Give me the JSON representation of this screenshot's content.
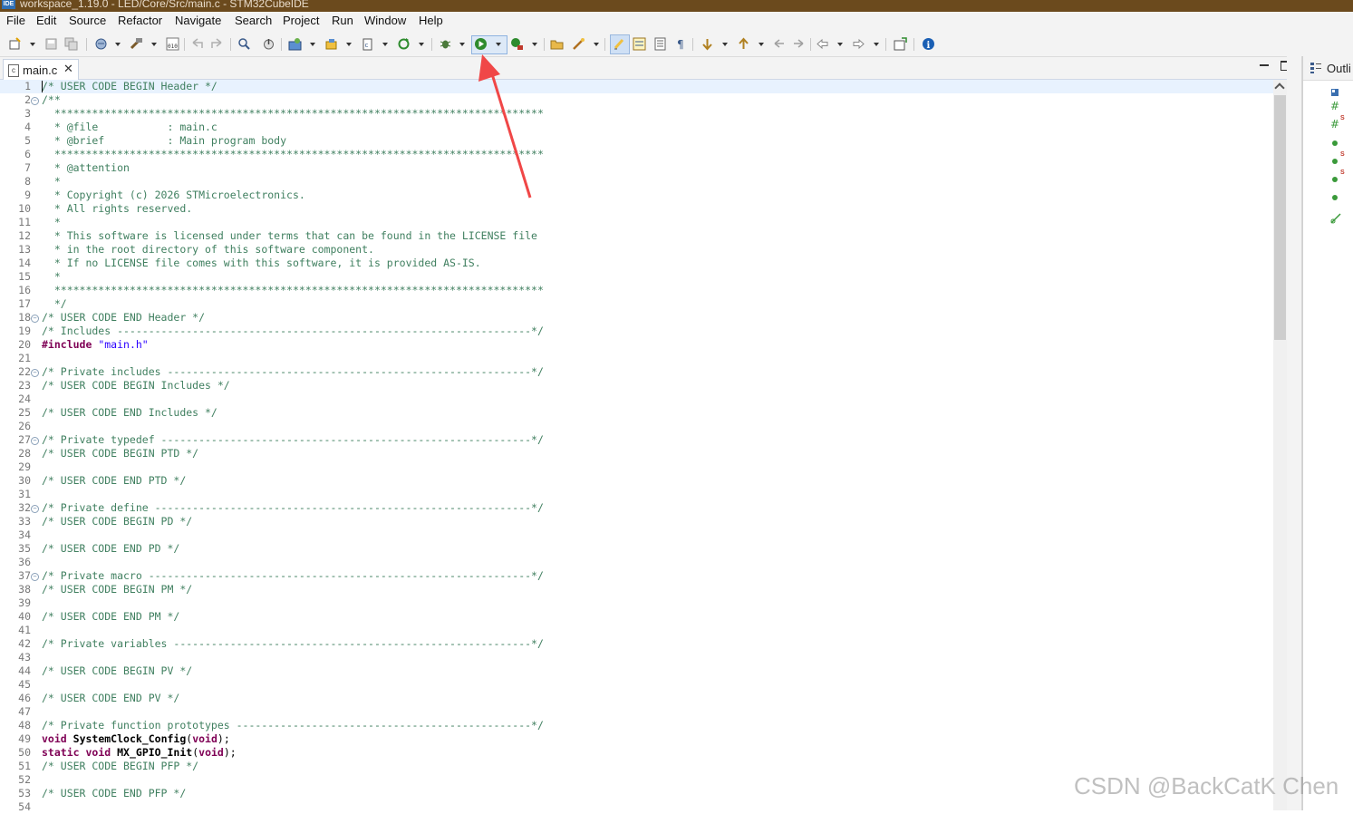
{
  "window": {
    "title": "workspace_1.19.0 - LED/Core/Src/main.c - STM32CubeIDE",
    "logo_text": "IDE"
  },
  "menu": [
    "File",
    "Edit",
    "Source",
    "Refactor",
    "Navigate",
    "Search",
    "Project",
    "Run",
    "Window",
    "Help"
  ],
  "toolbar": {
    "icons": [
      "new-icon",
      "save-icon",
      "save-all-icon",
      "build-config-icon",
      "build-icon",
      "binary-icon",
      "undo-icon",
      "redo-icon",
      "search-icon",
      "debug-probe-icon",
      "device-config-icon",
      "cube-icon",
      "new-file-icon",
      "refresh-icon",
      "debug-icon",
      "run-icon",
      "external-tools-icon",
      "open-folder-icon",
      "wand-icon",
      "highlight-icon",
      "toggle-mark-icon",
      "block-select-icon",
      "whitespace-icon",
      "next-annotation-icon",
      "prev-annotation-icon",
      "last-edit-icon",
      "back-nav-icon",
      "back-icon",
      "forward-icon",
      "perspective-icon",
      "info-icon"
    ],
    "highlight_color": "#2e8b2e"
  },
  "editor": {
    "tab_label": "main.c",
    "tab_icon": "c-file-icon",
    "lines": [
      {
        "n": "1",
        "segs": [
          [
            "c",
            "/* USER CODE BEGIN Header */"
          ]
        ],
        "current": true
      },
      {
        "n": "2",
        "fold": true,
        "segs": [
          [
            "c",
            "/**"
          ]
        ]
      },
      {
        "n": "3",
        "segs": [
          [
            "c",
            "  ******************************************************************************"
          ]
        ]
      },
      {
        "n": "4",
        "segs": [
          [
            "c",
            "  * @file           : main.c"
          ]
        ]
      },
      {
        "n": "5",
        "segs": [
          [
            "c",
            "  * @brief          : Main program body"
          ]
        ]
      },
      {
        "n": "6",
        "segs": [
          [
            "c",
            "  ******************************************************************************"
          ]
        ]
      },
      {
        "n": "7",
        "segs": [
          [
            "c",
            "  * @attention"
          ]
        ]
      },
      {
        "n": "8",
        "segs": [
          [
            "c",
            "  *"
          ]
        ]
      },
      {
        "n": "9",
        "segs": [
          [
            "c",
            "  * Copyright (c) 2026 STMicroelectronics."
          ]
        ]
      },
      {
        "n": "10",
        "segs": [
          [
            "c",
            "  * All rights reserved."
          ]
        ]
      },
      {
        "n": "11",
        "segs": [
          [
            "c",
            "  *"
          ]
        ]
      },
      {
        "n": "12",
        "segs": [
          [
            "c",
            "  * This software is licensed under terms that can be found in the LICENSE file"
          ]
        ]
      },
      {
        "n": "13",
        "segs": [
          [
            "c",
            "  * in the root directory of this software component."
          ]
        ]
      },
      {
        "n": "14",
        "segs": [
          [
            "c",
            "  * If no LICENSE file comes with this software, it is provided AS-IS."
          ]
        ]
      },
      {
        "n": "15",
        "segs": [
          [
            "c",
            "  *"
          ]
        ]
      },
      {
        "n": "16",
        "segs": [
          [
            "c",
            "  ******************************************************************************"
          ]
        ]
      },
      {
        "n": "17",
        "segs": [
          [
            "c",
            "  */"
          ]
        ]
      },
      {
        "n": "18",
        "fold": true,
        "segs": [
          [
            "c",
            "/* USER CODE END Header */"
          ]
        ]
      },
      {
        "n": "19",
        "segs": [
          [
            "c",
            "/* Includes ------------------------------------------------------------------*/"
          ]
        ]
      },
      {
        "n": "20",
        "segs": [
          [
            "k",
            "#include"
          ],
          [
            "p",
            " "
          ],
          [
            "s",
            "\"main.h\""
          ]
        ]
      },
      {
        "n": "21",
        "segs": []
      },
      {
        "n": "22",
        "fold": true,
        "segs": [
          [
            "c",
            "/* Private includes ----------------------------------------------------------*/"
          ]
        ]
      },
      {
        "n": "23",
        "segs": [
          [
            "c",
            "/* USER CODE BEGIN Includes */"
          ]
        ]
      },
      {
        "n": "24",
        "segs": []
      },
      {
        "n": "25",
        "segs": [
          [
            "c",
            "/* USER CODE END Includes */"
          ]
        ]
      },
      {
        "n": "26",
        "segs": []
      },
      {
        "n": "27",
        "fold": true,
        "segs": [
          [
            "c",
            "/* Private typedef -----------------------------------------------------------*/"
          ]
        ]
      },
      {
        "n": "28",
        "segs": [
          [
            "c",
            "/* USER CODE BEGIN PTD */"
          ]
        ]
      },
      {
        "n": "29",
        "segs": []
      },
      {
        "n": "30",
        "segs": [
          [
            "c",
            "/* USER CODE END PTD */"
          ]
        ]
      },
      {
        "n": "31",
        "segs": []
      },
      {
        "n": "32",
        "fold": true,
        "segs": [
          [
            "c",
            "/* Private define ------------------------------------------------------------*/"
          ]
        ]
      },
      {
        "n": "33",
        "segs": [
          [
            "c",
            "/* USER CODE BEGIN PD */"
          ]
        ]
      },
      {
        "n": "34",
        "segs": []
      },
      {
        "n": "35",
        "segs": [
          [
            "c",
            "/* USER CODE END PD */"
          ]
        ]
      },
      {
        "n": "36",
        "segs": []
      },
      {
        "n": "37",
        "fold": true,
        "segs": [
          [
            "c",
            "/* Private macro -------------------------------------------------------------*/"
          ]
        ]
      },
      {
        "n": "38",
        "segs": [
          [
            "c",
            "/* USER CODE BEGIN PM */"
          ]
        ]
      },
      {
        "n": "39",
        "segs": []
      },
      {
        "n": "40",
        "segs": [
          [
            "c",
            "/* USER CODE END PM */"
          ]
        ]
      },
      {
        "n": "41",
        "segs": []
      },
      {
        "n": "42",
        "segs": [
          [
            "c",
            "/* Private variables ---------------------------------------------------------*/"
          ]
        ]
      },
      {
        "n": "43",
        "segs": []
      },
      {
        "n": "44",
        "segs": [
          [
            "c",
            "/* USER CODE BEGIN PV */"
          ]
        ]
      },
      {
        "n": "45",
        "segs": []
      },
      {
        "n": "46",
        "segs": [
          [
            "c",
            "/* USER CODE END PV */"
          ]
        ]
      },
      {
        "n": "47",
        "segs": []
      },
      {
        "n": "48",
        "segs": [
          [
            "c",
            "/* Private function prototypes -----------------------------------------------*/"
          ]
        ]
      },
      {
        "n": "49",
        "segs": [
          [
            "k",
            "void"
          ],
          [
            "p",
            " "
          ],
          [
            "f",
            "SystemClock_Config"
          ],
          [
            "p",
            "("
          ],
          [
            "k",
            "void"
          ],
          [
            "p",
            ");"
          ]
        ]
      },
      {
        "n": "50",
        "segs": [
          [
            "k",
            "static"
          ],
          [
            "p",
            " "
          ],
          [
            "k",
            "void"
          ],
          [
            "p",
            " "
          ],
          [
            "f",
            "MX_GPIO_Init"
          ],
          [
            "p",
            "("
          ],
          [
            "k",
            "void"
          ],
          [
            "p",
            ");"
          ]
        ]
      },
      {
        "n": "51",
        "segs": [
          [
            "c",
            "/* USER CODE BEGIN PFP */"
          ]
        ]
      },
      {
        "n": "52",
        "segs": []
      },
      {
        "n": "53",
        "segs": [
          [
            "c",
            "/* USER CODE END PFP */"
          ]
        ]
      },
      {
        "n": "54",
        "segs": []
      }
    ]
  },
  "outline": {
    "label": "Outli",
    "icon": "outline-icon",
    "items": [
      "include-icon",
      "define-icon",
      "define-icon",
      "function-icon",
      "function-icon",
      "function-icon",
      "function-icon",
      "link-icon"
    ]
  },
  "watermark": "CSDN @BackCatK Chen",
  "annotation": {
    "color": "#f04747",
    "points_to": "run-icon"
  }
}
